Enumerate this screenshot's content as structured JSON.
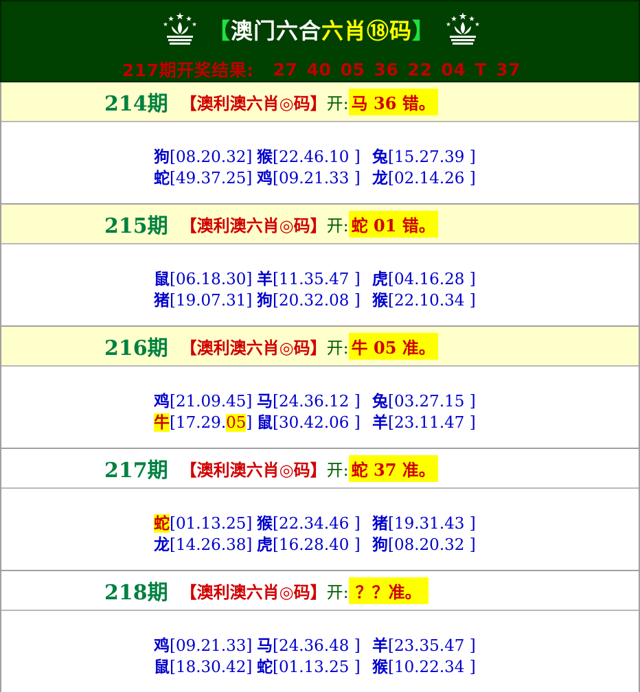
{
  "header": {
    "bracket_open": "【",
    "title_part1": "澳门六合",
    "title_part2": "六肖⑱码",
    "bracket_close": "】",
    "result_label": "217期开奖结果:",
    "result_numbers": "27 40 05 36 22 04 T 37"
  },
  "sections": [
    {
      "period": "214期",
      "label": "【澳利澳六肖◎码】",
      "open_label": "开:",
      "result": "马 36 错。",
      "head_bg": "yellow",
      "rows": [
        [
          {
            "z": "狗",
            "n": "[08.20.32]"
          },
          {
            "z": "猴",
            "n": "[22.46.10 ]"
          },
          {
            "z": "兔",
            "n": "[15.27.39 ]"
          }
        ],
        [
          {
            "z": "蛇",
            "n": "[49.37.25]"
          },
          {
            "z": "鸡",
            "n": "[09.21.33 ]"
          },
          {
            "z": "龙",
            "n": "[02.14.26 ]"
          }
        ]
      ]
    },
    {
      "period": "215期",
      "label": "【澳利澳六肖◎码】",
      "open_label": "开:",
      "result": "蛇 01 错。",
      "head_bg": "yellow",
      "rows": [
        [
          {
            "z": "鼠",
            "n": "[06.18.30]"
          },
          {
            "z": "羊",
            "n": "[11.35.47 ]"
          },
          {
            "z": "虎",
            "n": "[04.16.28 ]"
          }
        ],
        [
          {
            "z": "猪",
            "n": "[19.07.31]"
          },
          {
            "z": "狗",
            "n": "[20.32.08 ]"
          },
          {
            "z": "猴",
            "n": "[22.10.34 ]"
          }
        ]
      ]
    },
    {
      "period": "216期",
      "label": "【澳利澳六肖◎码】",
      "open_label": "开:",
      "result": "牛 05 准。",
      "head_bg": "yellow",
      "rows": [
        [
          {
            "z": "鸡",
            "n": "[21.09.45]"
          },
          {
            "z": "马",
            "n": "[24.36.12 ]"
          },
          {
            "z": "兔",
            "n": "[03.27.15 ]"
          }
        ],
        [
          {
            "z": "牛",
            "n": "[17.29.",
            "hit": "05",
            "tail": "]",
            "mark": true
          },
          {
            "z": "鼠",
            "n": "[30.42.06 ]"
          },
          {
            "z": "羊",
            "n": "[23.11.47 ]"
          }
        ]
      ]
    },
    {
      "period": "217期",
      "label": "【澳利澳六肖◎码】",
      "open_label": "开:",
      "result": "蛇 37 准。",
      "head_bg": "white",
      "rows": [
        [
          {
            "z": "蛇",
            "n": "[01.13.25]",
            "mark": true
          },
          {
            "z": "猴",
            "n": "[22.34.46 ]"
          },
          {
            "z": "猪",
            "n": "[19.31.43 ]"
          }
        ],
        [
          {
            "z": "龙",
            "n": "[14.26.38]"
          },
          {
            "z": "虎",
            "n": "[16.28.40 ]"
          },
          {
            "z": "狗",
            "n": "[08.20.32 ]"
          }
        ]
      ]
    },
    {
      "period": "218期",
      "label": "【澳利澳六肖◎码】",
      "open_label": "开:",
      "result": "？？准。",
      "head_bg": "white",
      "rows": [
        [
          {
            "z": "鸡",
            "n": "[09.21.33]"
          },
          {
            "z": "马",
            "n": "[24.36.48 ]"
          },
          {
            "z": "羊",
            "n": "[23.35.47 ]"
          }
        ],
        [
          {
            "z": "鼠",
            "n": "[18.30.42]"
          },
          {
            "z": "蛇",
            "n": "[01.13.25 ]"
          },
          {
            "z": "猴",
            "n": "[10.22.34 ]"
          }
        ]
      ]
    }
  ]
}
